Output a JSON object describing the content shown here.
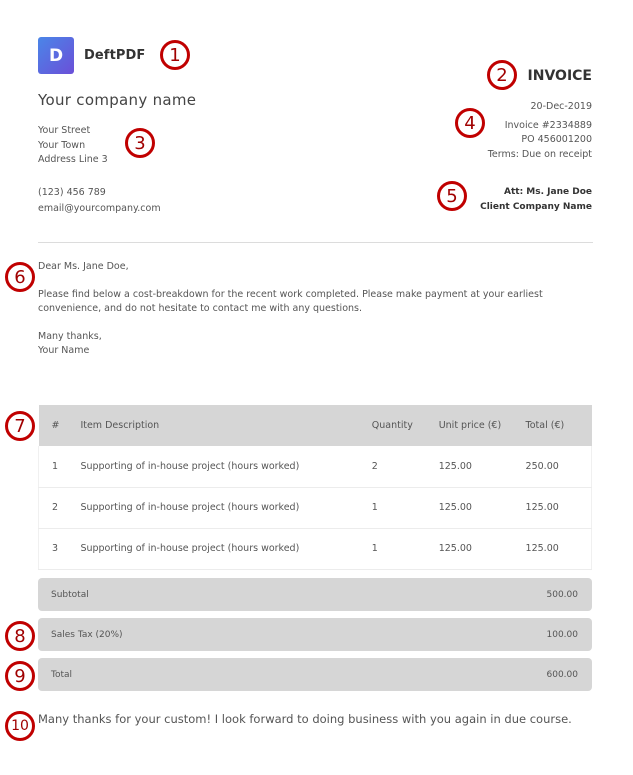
{
  "logo": {
    "letter": "D",
    "name": "DeftPDF",
    "gradient_from": "#4a86e8",
    "gradient_to": "#6b4fd8"
  },
  "sender": {
    "company_name": "Your company name",
    "street": "Your Street",
    "town": "Your Town",
    "address_line_3": "Address Line 3",
    "phone": "(123) 456 789",
    "email": "email@yourcompany.com"
  },
  "invoice": {
    "title": "INVOICE",
    "date": "20-Dec-2019",
    "number": "Invoice #2334889",
    "po": "PO 456001200",
    "terms": "Terms: Due on receipt"
  },
  "recipient": {
    "attention": "Att: Ms. Jane Doe",
    "company": "Client Company Name"
  },
  "letter": {
    "greeting": "Dear Ms. Jane Doe,",
    "body": "Please find below a cost-breakdown for the recent work completed. Please make payment at your earliest convenience, and do not hesitate to contact me with any questions.",
    "signoff": "Many thanks,",
    "signature": "Your Name"
  },
  "table": {
    "headers": [
      "#",
      "Item Description",
      "Quantity",
      "Unit price (€)",
      "Total (€)"
    ],
    "rows": [
      {
        "num": "1",
        "description": "Supporting of in-house project (hours worked)",
        "quantity": "2",
        "unit_price": "125.00",
        "total": "250.00"
      },
      {
        "num": "2",
        "description": "Supporting of in-house project (hours worked)",
        "quantity": "1",
        "unit_price": "125.00",
        "total": "125.00"
      },
      {
        "num": "3",
        "description": "Supporting of in-house project (hours worked)",
        "quantity": "1",
        "unit_price": "125.00",
        "total": "125.00"
      }
    ]
  },
  "summary": {
    "subtotal_label": "Subtotal",
    "subtotal_value": "500.00",
    "tax_label": "Sales Tax (20%)",
    "tax_value": "100.00",
    "total_label": "Total",
    "total_value": "600.00"
  },
  "closing": "Many thanks for your custom! I look forward to doing business with you again in due course.",
  "markers": [
    "1",
    "2",
    "3",
    "4",
    "5",
    "6",
    "7",
    "8",
    "9",
    "10"
  ],
  "colors": {
    "marker": "#c00000",
    "header_bg": "#d6d6d6"
  }
}
